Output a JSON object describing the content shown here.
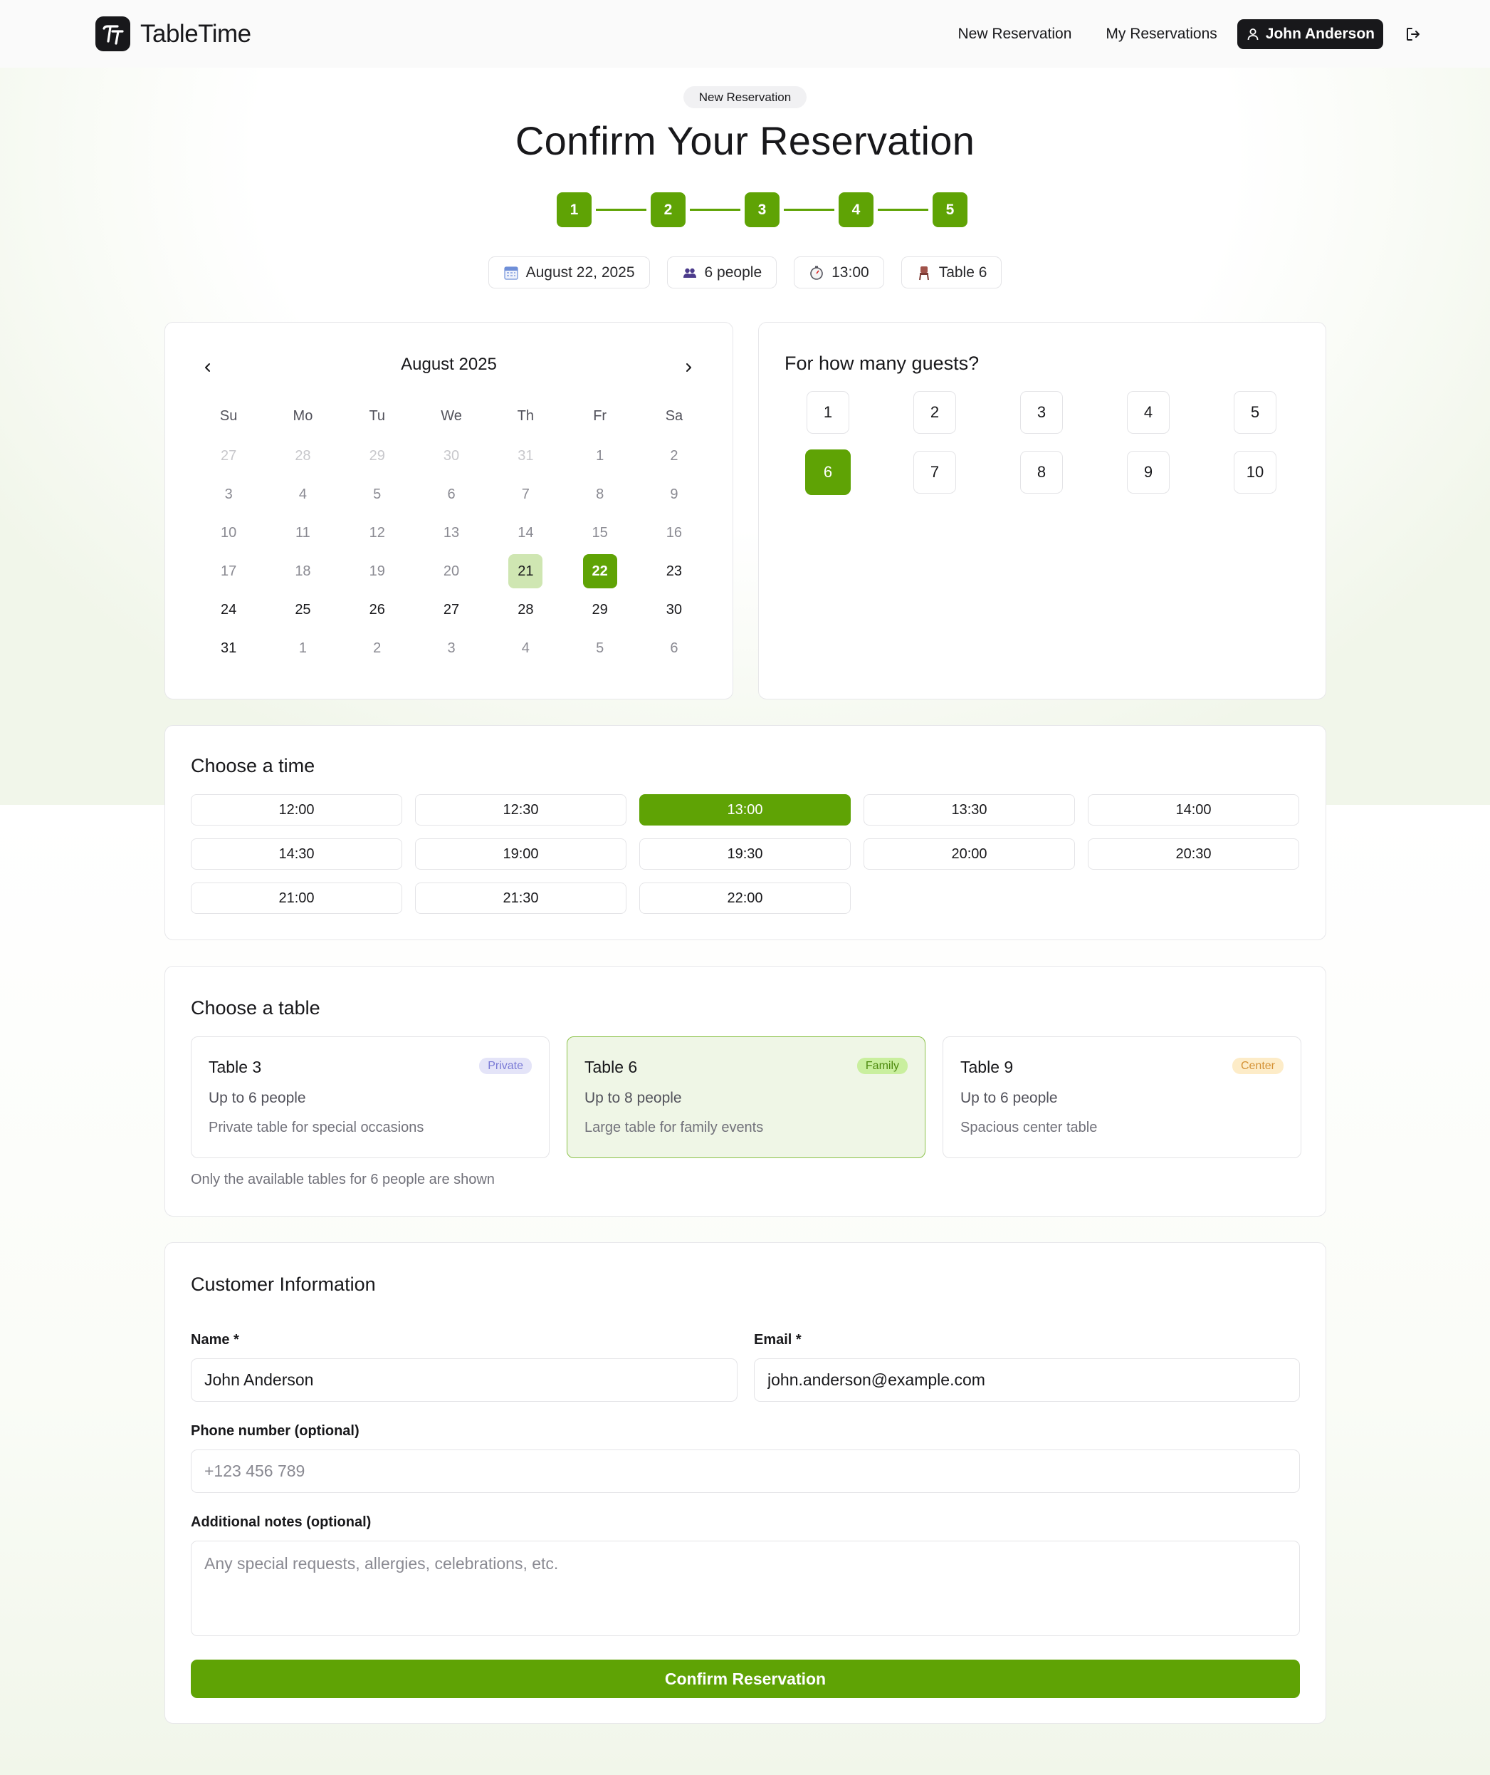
{
  "app": {
    "name": "TableTime"
  },
  "nav": {
    "new_reservation": "New Reservation",
    "my_reservations": "My Reservations",
    "user_name": "John Anderson"
  },
  "hero": {
    "badge": "New Reservation",
    "title": "Confirm Your Reservation",
    "steps": [
      "1",
      "2",
      "3",
      "4",
      "5"
    ],
    "accent_color": "#5fa305"
  },
  "summary": {
    "date": "August 22, 2025",
    "guests": "6 people",
    "time": "13:00",
    "table": "Table 6"
  },
  "calendar": {
    "month_label": "August 2025",
    "weekdays": [
      "Su",
      "Mo",
      "Tu",
      "We",
      "Th",
      "Fr",
      "Sa"
    ],
    "weeks": [
      [
        "27",
        "28",
        "29",
        "30",
        "31",
        "1",
        "2"
      ],
      [
        "3",
        "4",
        "5",
        "6",
        "7",
        "8",
        "9"
      ],
      [
        "10",
        "11",
        "12",
        "13",
        "14",
        "15",
        "16"
      ],
      [
        "17",
        "18",
        "19",
        "20",
        "21",
        "22",
        "23"
      ],
      [
        "24",
        "25",
        "26",
        "27",
        "28",
        "29",
        "30"
      ],
      [
        "31",
        "1",
        "2",
        "3",
        "4",
        "5",
        "6"
      ]
    ],
    "today": "21",
    "selected": "22"
  },
  "guests": {
    "title": "For how many guests?",
    "options": [
      "1",
      "2",
      "3",
      "4",
      "5",
      "6",
      "7",
      "8",
      "9",
      "10"
    ],
    "selected": "6"
  },
  "time": {
    "title": "Choose a time",
    "options": [
      "12:00",
      "12:30",
      "13:00",
      "13:30",
      "14:00",
      "14:30",
      "19:00",
      "19:30",
      "20:00",
      "20:30",
      "21:00",
      "21:30",
      "22:00"
    ],
    "selected": "13:00"
  },
  "tables": {
    "title": "Choose a table",
    "items": [
      {
        "name": "Table 3",
        "tag": "Private",
        "capacity": "Up to 6 people",
        "description": "Private table for special occasions"
      },
      {
        "name": "Table 6",
        "tag": "Family",
        "capacity": "Up to 8 people",
        "description": "Large table for family events"
      },
      {
        "name": "Table 9",
        "tag": "Center",
        "capacity": "Up to 6 people",
        "description": "Spacious center table"
      }
    ],
    "selected": "Table 6",
    "note": "Only the available tables for 6 people are shown"
  },
  "customer": {
    "title": "Customer Information",
    "name_label": "Name *",
    "name_value": "John Anderson",
    "email_label": "Email *",
    "email_value": "john.anderson@example.com",
    "phone_label": "Phone number (optional)",
    "phone_placeholder": "+123 456 789",
    "notes_label": "Additional notes (optional)",
    "notes_placeholder": "Any special requests, allergies, celebrations, etc.",
    "confirm_label": "Confirm Reservation"
  }
}
